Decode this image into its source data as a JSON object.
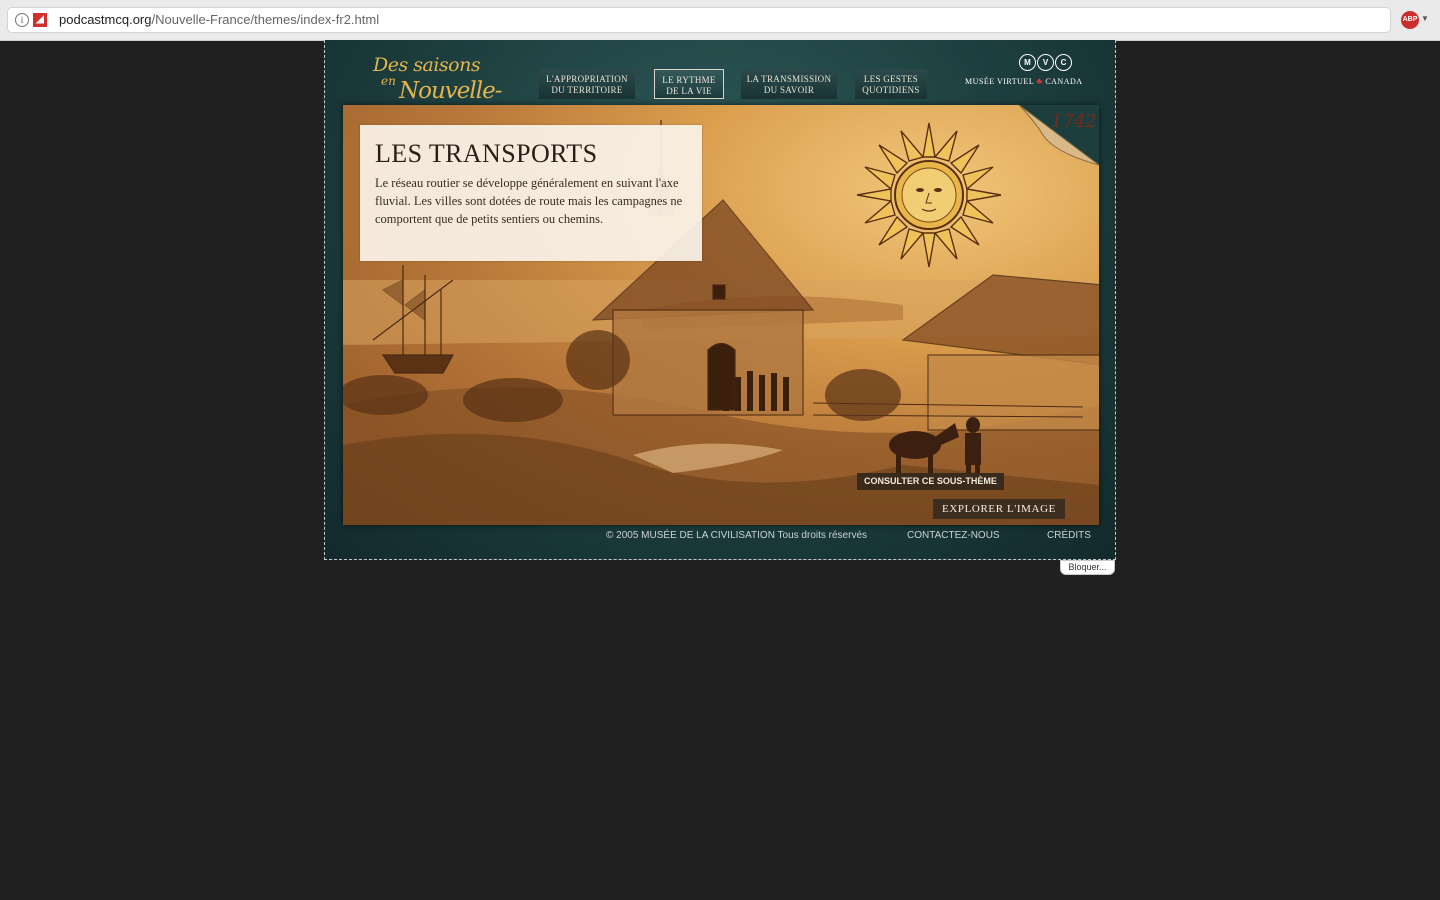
{
  "browser": {
    "url_domain": "podcastmcq.org",
    "url_path": "/Nouvelle-France/themes/index-fr2.html",
    "info_icon": "i",
    "adblock_label": "ABP"
  },
  "site": {
    "logo_line1": "Des saisons",
    "logo_line2": "en",
    "logo_line3": "Nouvelle-France",
    "nav": [
      {
        "line1": "L'APPROPRIATION",
        "line2": "DU TERRITOIRE"
      },
      {
        "line1": "LE RYTHME",
        "line2": "DE LA VIE"
      },
      {
        "line1": "LA TRANSMISSION",
        "line2": "DU SAVOIR"
      },
      {
        "line1": "LES GESTES",
        "line2": "QUOTIDIENS"
      }
    ],
    "mvc_letters": [
      "M",
      "V",
      "C"
    ],
    "mvc_left": "MUSÉE VIRTUEL",
    "mvc_right": "CANADA"
  },
  "panel": {
    "year": "1742",
    "title": "LES TRANSPORTS",
    "body": "Le réseau routier se développe généralement en suivant l'axe fluvial. Les villes sont dotées de route mais les campagnes ne comportent que de petits sentiers ou chemins.",
    "consult_button": "CONSULTER CE SOUS-THÈME",
    "explore_button": "EXPLORER L'IMAGE"
  },
  "footer": {
    "copyright": "© 2005 MUSÉE DE LA CIVILISATION",
    "rights": "Tous droits réservés",
    "contact": "CONTACTEZ-NOUS",
    "credits": "CRÉDITS"
  },
  "bloquer": "Bloquer..."
}
